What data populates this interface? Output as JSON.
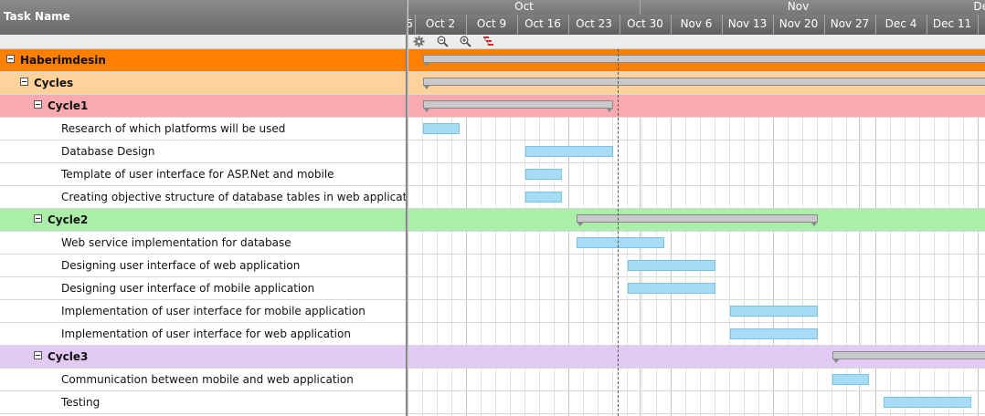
{
  "left_panel": {
    "header": "Task Name"
  },
  "timeline": {
    "months": [
      "Oct",
      "Nov",
      "Dec"
    ],
    "weeks": [
      "5",
      "Oct 2",
      "Oct 9",
      "Oct 16",
      "Oct 23",
      "Oct 30",
      "Nov 6",
      "Nov 13",
      "Nov 20",
      "Nov 27",
      "Dec 4",
      "Dec 11"
    ],
    "tools": [
      "gear-icon",
      "zoom-out-icon",
      "zoom-in-icon",
      "critical-path-icon"
    ]
  },
  "colors": {
    "project": "#ff8000",
    "cycles": "#ffd29c",
    "cycle1": "#f9aab0",
    "cycle2": "#aaeeaa",
    "cycle3": "#e2caf5",
    "task_bar": "#a6dcf6",
    "summary_bar": "#c9c9c9"
  },
  "rows": [
    {
      "label": "Haberimdesin",
      "type": "summary",
      "level": 0,
      "color": "#ff8000",
      "start": "2017-09-30",
      "end": "2017-12-17"
    },
    {
      "label": "Cycles",
      "type": "summary",
      "level": 1,
      "color": "#ffd29c",
      "start": "2017-09-30",
      "end": "2017-12-17"
    },
    {
      "label": "Cycle1",
      "type": "summary",
      "level": 2,
      "color": "#f9aab0",
      "start": "2017-09-30",
      "end": "2017-10-26"
    },
    {
      "label": "Research of which platforms will be used",
      "type": "task",
      "level": 3,
      "start": "2017-09-30",
      "end": "2017-10-05"
    },
    {
      "label": "Database Design",
      "type": "task",
      "level": 3,
      "start": "2017-10-14",
      "end": "2017-10-26"
    },
    {
      "label": "Template of user interface for ASP.Net and mobile",
      "type": "task",
      "level": 3,
      "start": "2017-10-14",
      "end": "2017-10-19"
    },
    {
      "label": "Creating objective structure of database tables in web application",
      "type": "task",
      "level": 3,
      "start": "2017-10-14",
      "end": "2017-10-19"
    },
    {
      "label": "Cycle2",
      "type": "summary",
      "level": 2,
      "color": "#aaeeaa",
      "start": "2017-10-21",
      "end": "2017-11-23"
    },
    {
      "label": "Web service implementation for database",
      "type": "task",
      "level": 3,
      "start": "2017-10-21",
      "end": "2017-11-02"
    },
    {
      "label": "Designing user interface of web application",
      "type": "task",
      "level": 3,
      "start": "2017-10-28",
      "end": "2017-11-09"
    },
    {
      "label": "Designing user interface of mobile application",
      "type": "task",
      "level": 3,
      "start": "2017-10-28",
      "end": "2017-11-09"
    },
    {
      "label": "Implementation of user interface for mobile application",
      "type": "task",
      "level": 3,
      "start": "2017-11-11",
      "end": "2017-11-23"
    },
    {
      "label": "Implementation of user interface for web application",
      "type": "task",
      "level": 3,
      "start": "2017-11-11",
      "end": "2017-11-23"
    },
    {
      "label": "Cycle3",
      "type": "summary",
      "level": 2,
      "color": "#e2caf5",
      "start": "2017-11-25",
      "end": "2017-12-17"
    },
    {
      "label": "Communication between mobile and web application",
      "type": "task",
      "level": 3,
      "start": "2017-11-25",
      "end": "2017-11-30"
    },
    {
      "label": "Testing",
      "type": "task",
      "level": 3,
      "start": "2017-12-02",
      "end": "2017-12-14"
    }
  ]
}
